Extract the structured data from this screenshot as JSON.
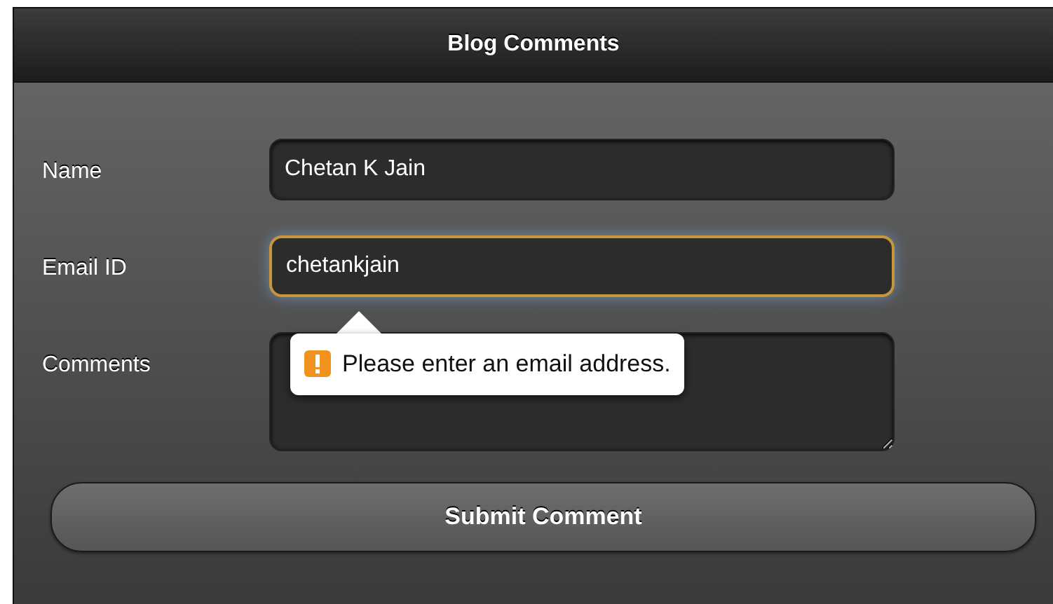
{
  "header": {
    "title": "Blog Comments"
  },
  "fields": [
    {
      "kind": "text",
      "label": "Name",
      "value": "Chetan K Jain",
      "focused": false
    },
    {
      "kind": "text",
      "label": "Email ID",
      "value": "chetankjain",
      "focused": true,
      "error_tooltip": "Please enter an email address."
    },
    {
      "kind": "textarea",
      "label": "Comments",
      "focused": false
    }
  ],
  "submit_button": {
    "label": "Submit Comment"
  }
}
